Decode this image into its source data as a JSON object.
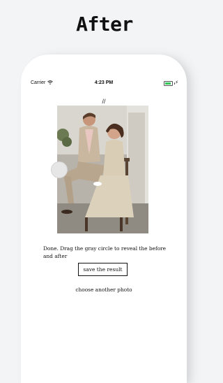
{
  "banner": {
    "title": "After"
  },
  "statusbar": {
    "carrier": "Carrier",
    "time": "4:23 PM",
    "battery_level": 0.9,
    "battery_color": "#35c759"
  },
  "nav": {
    "glyph": "//"
  },
  "photo": {
    "watermark": ""
  },
  "status_message": "Done. Drag the gray circle to reveal the before and after",
  "buttons": {
    "save_label": "save the result",
    "choose_label": "choose another photo"
  }
}
